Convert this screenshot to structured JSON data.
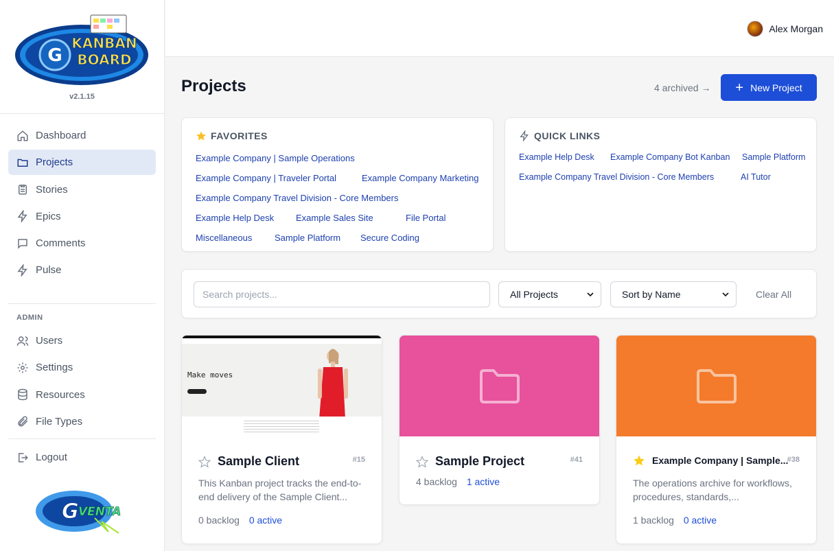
{
  "app": {
    "logo_text": "KANBAN BOARD",
    "logo_letter": "G",
    "version": "v2.1.15",
    "footer_logo_text": "GVENTA"
  },
  "sidebar": {
    "items": [
      {
        "label": "Dashboard",
        "icon": "home-icon"
      },
      {
        "label": "Projects",
        "icon": "folder-icon",
        "active": true
      },
      {
        "label": "Stories",
        "icon": "clipboard-icon"
      },
      {
        "label": "Epics",
        "icon": "bolt-icon"
      },
      {
        "label": "Comments",
        "icon": "comment-icon"
      },
      {
        "label": "Pulse",
        "icon": "bolt-icon"
      }
    ],
    "admin_label": "ADMIN",
    "admin_items": [
      {
        "label": "Users",
        "icon": "users-icon"
      },
      {
        "label": "Settings",
        "icon": "gear-icon"
      },
      {
        "label": "Resources",
        "icon": "database-icon"
      },
      {
        "label": "File Types",
        "icon": "paperclip-icon"
      }
    ],
    "logout_label": "Logout"
  },
  "header": {
    "user_name": "Alex Morgan"
  },
  "main": {
    "title": "Projects",
    "archived_link": "4 archived →",
    "new_project_label": "New Project"
  },
  "favorites": {
    "title": "FAVORITES",
    "links": [
      "Example Company | Sample Operations",
      "Example Company | Traveler Portal",
      "Example Company Marketing",
      "Example Company Travel Division - Core Members",
      "Example Help Desk",
      "Example Sales Site",
      "File Portal",
      "Miscellaneous",
      "Sample Platform",
      "Secure Coding"
    ]
  },
  "quick_links": {
    "title": "QUICK LINKS",
    "links": [
      "Example Help Desk",
      "Example Company Bot Kanban",
      "Sample Platform",
      "Example Company Travel Division - Core Members",
      "AI Tutor"
    ]
  },
  "filters": {
    "search_placeholder": "Search projects...",
    "project_filter": "All Projects",
    "sort": "Sort by Name",
    "clear_label": "Clear All"
  },
  "projects": [
    {
      "name": "Sample Client",
      "number": "#15",
      "description": "This Kanban project tracks the end-to-end delivery of the Sample Client...",
      "backlog": "0 backlog",
      "active": "0 active",
      "favorite": false,
      "thumbnail_headline": "Make moves"
    },
    {
      "name": "Sample Project",
      "number": "#41",
      "description": "",
      "backlog": "4 backlog",
      "active": "1 active",
      "favorite": false,
      "color": "#e8519b"
    },
    {
      "name": "Example Company | Sample...",
      "number": "#38",
      "description": "The operations archive for workflows, procedures, standards,...",
      "backlog": "1 backlog",
      "active": "0 active",
      "favorite": true,
      "color": "#f47b2c"
    }
  ]
}
